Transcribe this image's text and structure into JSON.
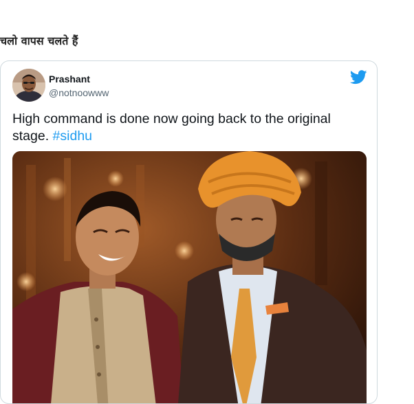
{
  "page": {
    "heading": "चलो वापस चलते हैं"
  },
  "tweet": {
    "author": {
      "name": "Prashant",
      "handle": "@notnoowww"
    },
    "text": "High command is done now going back to the original stage. ",
    "hashtag": "#sidhu",
    "icon": "twitter-bird-icon",
    "brand_color": "#1d9bf0"
  },
  "photo": {
    "description_icon": "tweet-photo"
  }
}
